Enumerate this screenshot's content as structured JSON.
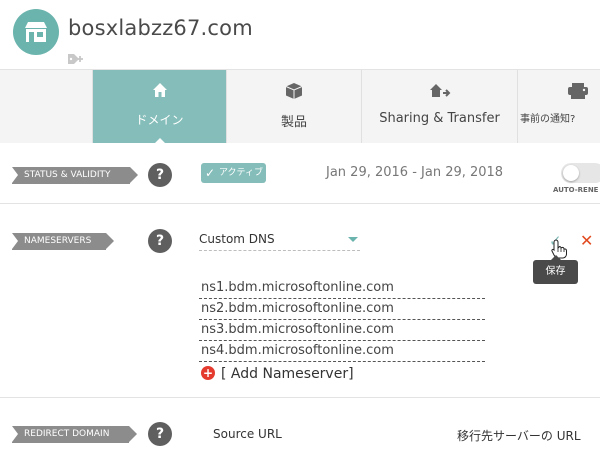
{
  "header": {
    "domain": "bosxlabzz67.com"
  },
  "tabs": [
    {
      "label": "ドメイン",
      "icon": "home-icon",
      "active": true
    },
    {
      "label": "製品",
      "icon": "box-icon",
      "active": false
    },
    {
      "label": "Sharing & Transfer",
      "icon": "share-transfer-icon",
      "active": false
    },
    {
      "label": "事前の通知?",
      "icon": "notification-icon",
      "active": false
    }
  ],
  "status": {
    "label": "STATUS & VALIDITY",
    "help": "?",
    "badge": "アクティブ",
    "date_range": "Jan 29, 2016 - Jan 29, 2018",
    "toggle_caption": "AUTO-RENE",
    "toggle_on": false
  },
  "nameservers": {
    "label": "NAMESERVERS",
    "help": "?",
    "type_selected": "Custom DNS",
    "save_tooltip": "保存",
    "entries": [
      "ns1.bdm.microsoftonline.com",
      "ns2.bdm.microsoftonline.com",
      "ns3.bdm.microsoftonline.com",
      "ns4.bdm.microsoftonline.com"
    ],
    "add_label": "[ Add Nameserver]"
  },
  "redirect": {
    "label": "REDIRECT DOMAIN",
    "help": "?",
    "source_col": "Source URL",
    "dest_col": "移行先サーバーの URL"
  },
  "colors": {
    "accent": "#84bdb9",
    "logo": "#6ab4ad",
    "danger": "#e24a1f"
  }
}
